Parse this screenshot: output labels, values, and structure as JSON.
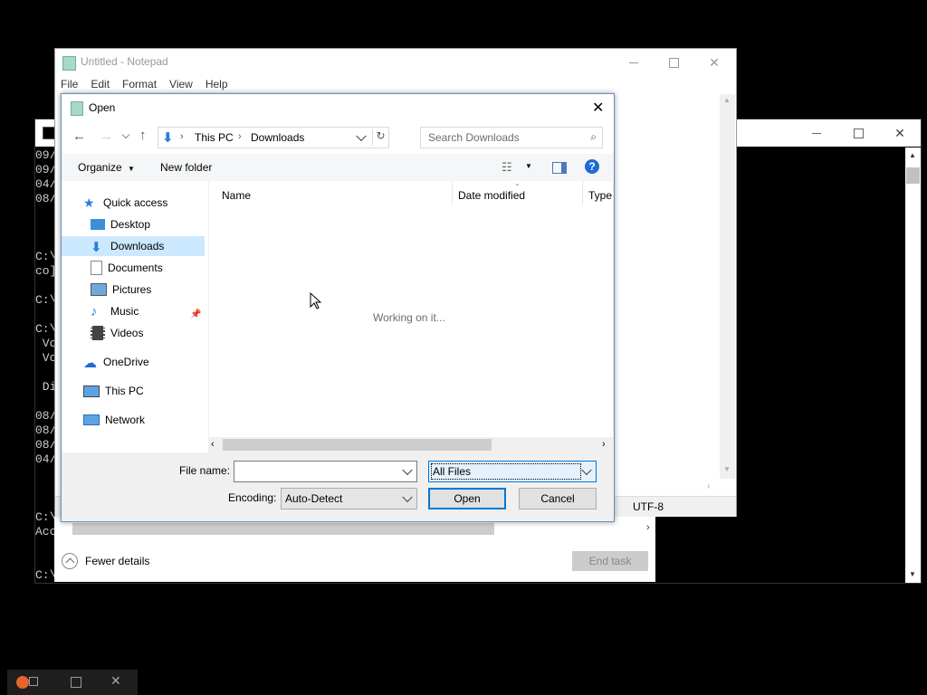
{
  "console": {
    "lines": [
      "09/",
      "09/",
      "04/",
      "08/",
      "",
      "",
      "",
      "C:\\",
      "co]",
      "",
      "C:\\",
      "",
      "C:\\",
      " Vo",
      " Vo",
      "",
      " Di",
      "",
      "08/",
      "08/",
      "08/",
      "04/",
      "",
      "",
      "",
      "C:\\",
      "Acc",
      "",
      "",
      "C:\\"
    ]
  },
  "notepad": {
    "title": "Untitled - Notepad",
    "menu": [
      "File",
      "Edit",
      "Format",
      "View",
      "Help"
    ],
    "encoding_status": "UTF-8"
  },
  "taskmgr": {
    "fewer_details": "Fewer details",
    "end_task": "End task"
  },
  "dialog": {
    "title": "Open",
    "breadcrumb": [
      "This PC",
      "Downloads"
    ],
    "search_placeholder": "Search Downloads",
    "organize": "Organize",
    "new_folder": "New folder",
    "columns": [
      "Name",
      "Date modified",
      "Type"
    ],
    "status": "Working on it...",
    "tree": {
      "quick_access": "Quick access",
      "desktop": "Desktop",
      "downloads": "Downloads",
      "documents": "Documents",
      "pictures": "Pictures",
      "music": "Music",
      "videos": "Videos",
      "onedrive": "OneDrive",
      "this_pc": "This PC",
      "network": "Network"
    },
    "file_name_label": "File name:",
    "file_name_value": "",
    "file_type": "All Files",
    "encoding_label": "Encoding:",
    "encoding_value": "Auto-Detect",
    "open_button": "Open",
    "cancel_button": "Cancel"
  },
  "colors": {
    "accent": "#0078d7",
    "selected_bg": "#cce8ff",
    "folder": "#e8b84a"
  }
}
